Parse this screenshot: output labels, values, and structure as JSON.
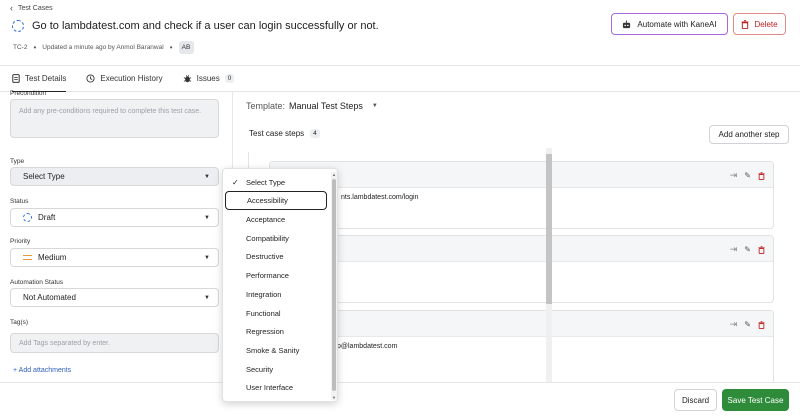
{
  "breadcrumb": "Test Cases",
  "title": "Go to lambdatest.com and check if a user can login successfully or not.",
  "meta": {
    "id": "TC-2",
    "updated": "Updated a minute ago by Anmol Baranwal",
    "avatar": "AB"
  },
  "header_buttons": {
    "automate": "Automate with KaneAI",
    "delete": "Delete"
  },
  "tabs": [
    {
      "label": "Test Details"
    },
    {
      "label": "Execution History"
    },
    {
      "label": "Issues",
      "count": "0"
    }
  ],
  "left": {
    "precondition_label": "Precondition",
    "precondition_placeholder": "Add any pre-conditions required to complete this test case.",
    "type_label": "Type",
    "type_value": "Select Type",
    "status_label": "Status",
    "status_value": "Draft",
    "priority_label": "Priority",
    "priority_value": "Medium",
    "automation_label": "Automation Status",
    "automation_value": "Not Automated",
    "tags_label": "Tag(s)",
    "tags_placeholder": "Add Tags separated by enter.",
    "add_attachments": "+ Add attachments"
  },
  "right": {
    "template_label": "Template:",
    "template_value": "Manual Test Steps",
    "steps_label": "Test case steps",
    "steps_count": "4",
    "add_step": "Add another step",
    "steps": [
      {
        "text": "nts.lambdatest.com/login"
      },
      {
        "text": ""
      },
      {
        "text": "p@lambdatest.com"
      }
    ]
  },
  "dropdown": {
    "selected": "Select Type",
    "options": [
      "Select Type",
      "Accessibility",
      "Acceptance",
      "Compatibility",
      "Destructive",
      "Performance",
      "Integration",
      "Functional",
      "Regression",
      "Smoke & Sanity",
      "Security",
      "User Interface"
    ]
  },
  "footer": {
    "discard": "Discard",
    "save": "Save Test Case"
  },
  "colors": {
    "accent_purple": "#a569d6",
    "delete_red": "#c02020",
    "save_green": "#2e8b3a",
    "status_blue": "#2e6fe0",
    "priority_orange": "#e59b2d"
  }
}
